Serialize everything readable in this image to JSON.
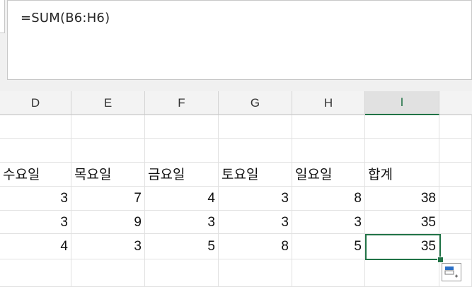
{
  "formula_bar": {
    "text": "=SUM(B6:H6)"
  },
  "columns": [
    {
      "label": "D",
      "active": false
    },
    {
      "label": "E",
      "active": false
    },
    {
      "label": "F",
      "active": false
    },
    {
      "label": "G",
      "active": false
    },
    {
      "label": "H",
      "active": false
    },
    {
      "label": "I",
      "active": true
    }
  ],
  "rows": [
    {
      "cells": [
        "",
        "",
        "",
        "",
        "",
        ""
      ],
      "type": "empty"
    },
    {
      "cells": [
        "",
        "",
        "",
        "",
        "",
        ""
      ],
      "type": "empty"
    },
    {
      "cells": [
        "수요일",
        "목요일",
        "금요일",
        "토요일",
        "일요일",
        "합계"
      ],
      "type": "header"
    },
    {
      "cells": [
        "3",
        "7",
        "4",
        "3",
        "8",
        "38"
      ],
      "type": "number"
    },
    {
      "cells": [
        "3",
        "9",
        "3",
        "3",
        "3",
        "35"
      ],
      "type": "number"
    },
    {
      "cells": [
        "4",
        "3",
        "5",
        "8",
        "5",
        "35"
      ],
      "type": "number"
    },
    {
      "cells": [
        "",
        "",
        "",
        "",
        "",
        ""
      ],
      "type": "empty"
    }
  ],
  "selected_cell": "I",
  "icons": {
    "quick_analysis": "quick-analysis-icon"
  },
  "colors": {
    "accent": "#217346",
    "gridline": "#e1e1e1",
    "header_bg": "#f3f3f3"
  }
}
